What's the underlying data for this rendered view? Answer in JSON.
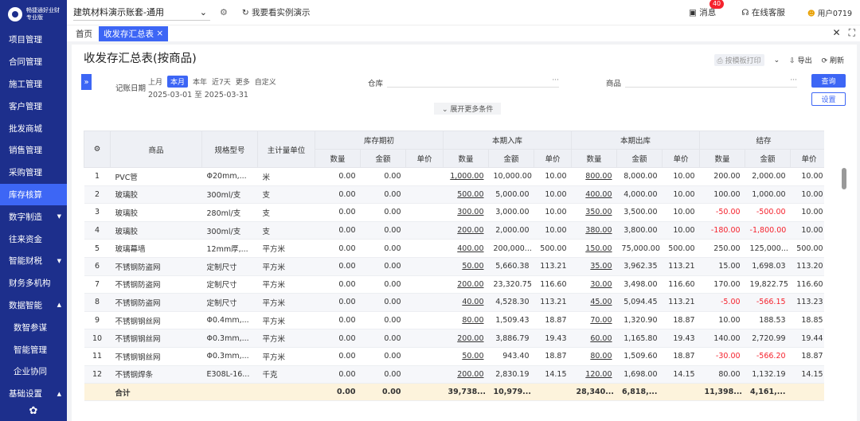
{
  "sidebar": {
    "brand": "畅捷通好业财",
    "edition": "专业版",
    "items": [
      {
        "label": "项目管理",
        "arrow": ""
      },
      {
        "label": "合同管理",
        "arrow": ""
      },
      {
        "label": "施工管理",
        "arrow": ""
      },
      {
        "label": "客户管理",
        "arrow": ""
      },
      {
        "label": "批发商城",
        "arrow": ""
      },
      {
        "label": "销售管理",
        "arrow": ""
      },
      {
        "label": "采购管理",
        "arrow": ""
      },
      {
        "label": "库存核算",
        "arrow": "",
        "active": true
      },
      {
        "label": "数字制造",
        "arrow": "▼"
      },
      {
        "label": "往来资金",
        "arrow": ""
      },
      {
        "label": "智能财税",
        "arrow": "▼"
      },
      {
        "label": "财务多机构",
        "arrow": ""
      },
      {
        "label": "数据智能",
        "arrow": "▲"
      },
      {
        "label": "数智参谋",
        "arrow": "",
        "sub": true
      },
      {
        "label": "智能管理",
        "arrow": "",
        "sub": true
      },
      {
        "label": "企业协同",
        "arrow": "",
        "sub": true
      },
      {
        "label": "基础设置",
        "arrow": "▲"
      }
    ]
  },
  "topbar": {
    "book": "建筑材料演示账套-通用",
    "demo": "我要看实例演示",
    "messages": "消息",
    "message_count": "40",
    "service": "在线客服",
    "user": "用户0719"
  },
  "tabs": {
    "home": "首页",
    "current": "收发存汇总表"
  },
  "page": {
    "title": "收发存汇总表(按商品)",
    "actions": {
      "print": "按模板打印",
      "export": "导出",
      "refresh": "刷新"
    }
  },
  "filters": {
    "period_label": "记账日期",
    "period_options": [
      "上月",
      "本月",
      "本年",
      "近7天",
      "更多",
      "自定义"
    ],
    "selected_option": "本月",
    "date_range": "2025-03-01 至 2025-03-31",
    "warehouse_label": "仓库",
    "product_label": "商品",
    "query": "查询",
    "settings": "设置",
    "more_conditions": "展开更多条件"
  },
  "table": {
    "headers": {
      "product": "商品",
      "spec": "规格型号",
      "unit": "主计量单位",
      "groups": [
        "库存期初",
        "本期入库",
        "本期出库",
        "结存"
      ],
      "sub": [
        "数量",
        "金额",
        "单价"
      ]
    },
    "rows": [
      {
        "no": "1",
        "name": "PVC管",
        "spec": "Φ20mm,...",
        "unit": "米",
        "open": [
          "0.00",
          "0.00",
          ""
        ],
        "in": [
          "1,000.00",
          "10,000.00",
          "10.00"
        ],
        "out": [
          "800.00",
          "8,000.00",
          "10.00"
        ],
        "bal": [
          "200.00",
          "2,000.00",
          "10.00"
        ]
      },
      {
        "no": "2",
        "name": "玻璃胶",
        "spec": "300ml/支",
        "unit": "支",
        "open": [
          "0.00",
          "0.00",
          ""
        ],
        "in": [
          "500.00",
          "5,000.00",
          "10.00"
        ],
        "out": [
          "400.00",
          "4,000.00",
          "10.00"
        ],
        "bal": [
          "100.00",
          "1,000.00",
          "10.00"
        ]
      },
      {
        "no": "3",
        "name": "玻璃胶",
        "spec": "280ml/支",
        "unit": "支",
        "open": [
          "0.00",
          "0.00",
          ""
        ],
        "in": [
          "300.00",
          "3,000.00",
          "10.00"
        ],
        "out": [
          "350.00",
          "3,500.00",
          "10.00"
        ],
        "bal": [
          "-50.00",
          "-500.00",
          "10.00"
        ]
      },
      {
        "no": "4",
        "name": "玻璃胶",
        "spec": "300ml/支",
        "unit": "支",
        "open": [
          "0.00",
          "0.00",
          ""
        ],
        "in": [
          "200.00",
          "2,000.00",
          "10.00"
        ],
        "out": [
          "380.00",
          "3,800.00",
          "10.00"
        ],
        "bal": [
          "-180.00",
          "-1,800.00",
          "10.00"
        ]
      },
      {
        "no": "5",
        "name": "玻璃幕墙",
        "spec": "12mm厚,...",
        "unit": "平方米",
        "open": [
          "0.00",
          "0.00",
          ""
        ],
        "in": [
          "400.00",
          "200,000...",
          "500.00"
        ],
        "out": [
          "150.00",
          "75,000.00",
          "500.00"
        ],
        "bal": [
          "250.00",
          "125,000...",
          "500.00"
        ]
      },
      {
        "no": "6",
        "name": "不锈钢防盗网",
        "spec": "定制尺寸",
        "unit": "平方米",
        "open": [
          "0.00",
          "0.00",
          ""
        ],
        "in": [
          "50.00",
          "5,660.38",
          "113.21"
        ],
        "out": [
          "35.00",
          "3,962.35",
          "113.21"
        ],
        "bal": [
          "15.00",
          "1,698.03",
          "113.20"
        ]
      },
      {
        "no": "7",
        "name": "不锈钢防盗网",
        "spec": "定制尺寸",
        "unit": "平方米",
        "open": [
          "0.00",
          "0.00",
          ""
        ],
        "in": [
          "200.00",
          "23,320.75",
          "116.60"
        ],
        "out": [
          "30.00",
          "3,498.00",
          "116.60"
        ],
        "bal": [
          "170.00",
          "19,822.75",
          "116.60"
        ]
      },
      {
        "no": "8",
        "name": "不锈钢防盗网",
        "spec": "定制尺寸",
        "unit": "平方米",
        "open": [
          "0.00",
          "0.00",
          ""
        ],
        "in": [
          "40.00",
          "4,528.30",
          "113.21"
        ],
        "out": [
          "45.00",
          "5,094.45",
          "113.21"
        ],
        "bal": [
          "-5.00",
          "-566.15",
          "113.23"
        ]
      },
      {
        "no": "9",
        "name": "不锈钢钢丝网",
        "spec": "Φ0.4mm,...",
        "unit": "平方米",
        "open": [
          "0.00",
          "0.00",
          ""
        ],
        "in": [
          "80.00",
          "1,509.43",
          "18.87"
        ],
        "out": [
          "70.00",
          "1,320.90",
          "18.87"
        ],
        "bal": [
          "10.00",
          "188.53",
          "18.85"
        ]
      },
      {
        "no": "10",
        "name": "不锈钢钢丝网",
        "spec": "Φ0.3mm,...",
        "unit": "平方米",
        "open": [
          "0.00",
          "0.00",
          ""
        ],
        "in": [
          "200.00",
          "3,886.79",
          "19.43"
        ],
        "out": [
          "60.00",
          "1,165.80",
          "19.43"
        ],
        "bal": [
          "140.00",
          "2,720.99",
          "19.44"
        ]
      },
      {
        "no": "11",
        "name": "不锈钢钢丝网",
        "spec": "Φ0.3mm,...",
        "unit": "平方米",
        "open": [
          "0.00",
          "0.00",
          ""
        ],
        "in": [
          "50.00",
          "943.40",
          "18.87"
        ],
        "out": [
          "80.00",
          "1,509.60",
          "18.87"
        ],
        "bal": [
          "-30.00",
          "-566.20",
          "18.87"
        ]
      },
      {
        "no": "12",
        "name": "不锈钢焊条",
        "spec": "E308L-16...",
        "unit": "千克",
        "open": [
          "0.00",
          "0.00",
          ""
        ],
        "in": [
          "200.00",
          "2,830.19",
          "14.15"
        ],
        "out": [
          "120.00",
          "1,698.00",
          "14.15"
        ],
        "bal": [
          "80.00",
          "1,132.19",
          "14.15"
        ]
      }
    ],
    "total": {
      "label": "合计",
      "open": [
        "0.00",
        "0.00",
        ""
      ],
      "in": [
        "39,738...",
        "10,979...",
        ""
      ],
      "out": [
        "28,340...",
        "6,818,...",
        ""
      ],
      "bal": [
        "11,398...",
        "4,161,...",
        ""
      ]
    }
  },
  "colors": {
    "sidebar": "#1d2f8c",
    "accent": "#3d66f5",
    "negative": "#f5222d",
    "total_row": "#fdf3dc"
  }
}
